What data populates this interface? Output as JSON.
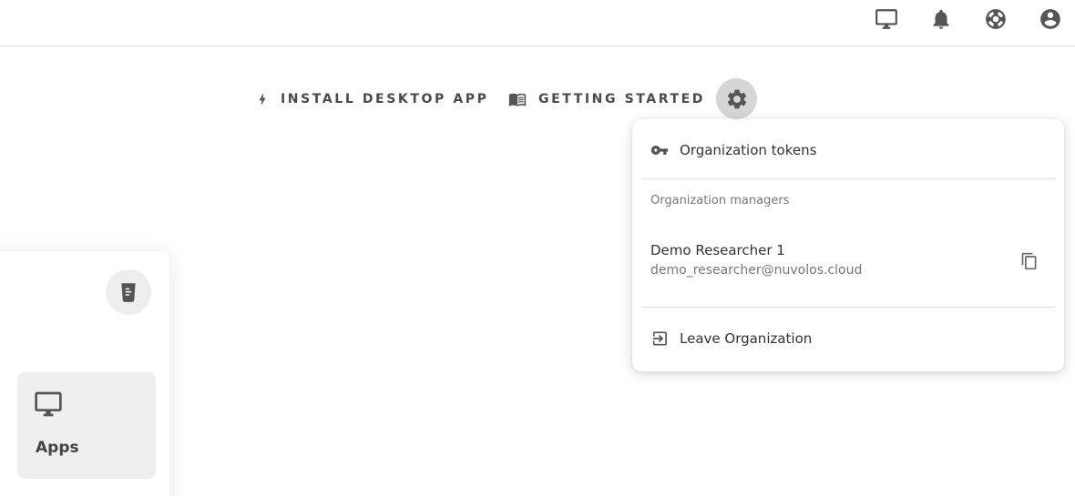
{
  "topbar": {
    "icons": [
      "monitor-icon",
      "bell-icon",
      "lifebuoy-icon",
      "account-circle-icon"
    ]
  },
  "actions": {
    "install_desktop_app": "INSTALL DESKTOP APP",
    "getting_started": "GETTING STARTED"
  },
  "settings_menu": {
    "organization_tokens": "Organization tokens",
    "managers_header": "Organization managers",
    "managers": [
      {
        "name": "Demo Researcher 1",
        "email": "demo_researcher@nuvolos.cloud"
      }
    ],
    "leave_organization": "Leave Organization"
  },
  "side_card": {
    "apps_label": "Apps"
  },
  "colors": {
    "icon": "#555555",
    "gear_button_bg": "#d6d6d6",
    "tile_bg": "#efefef"
  }
}
